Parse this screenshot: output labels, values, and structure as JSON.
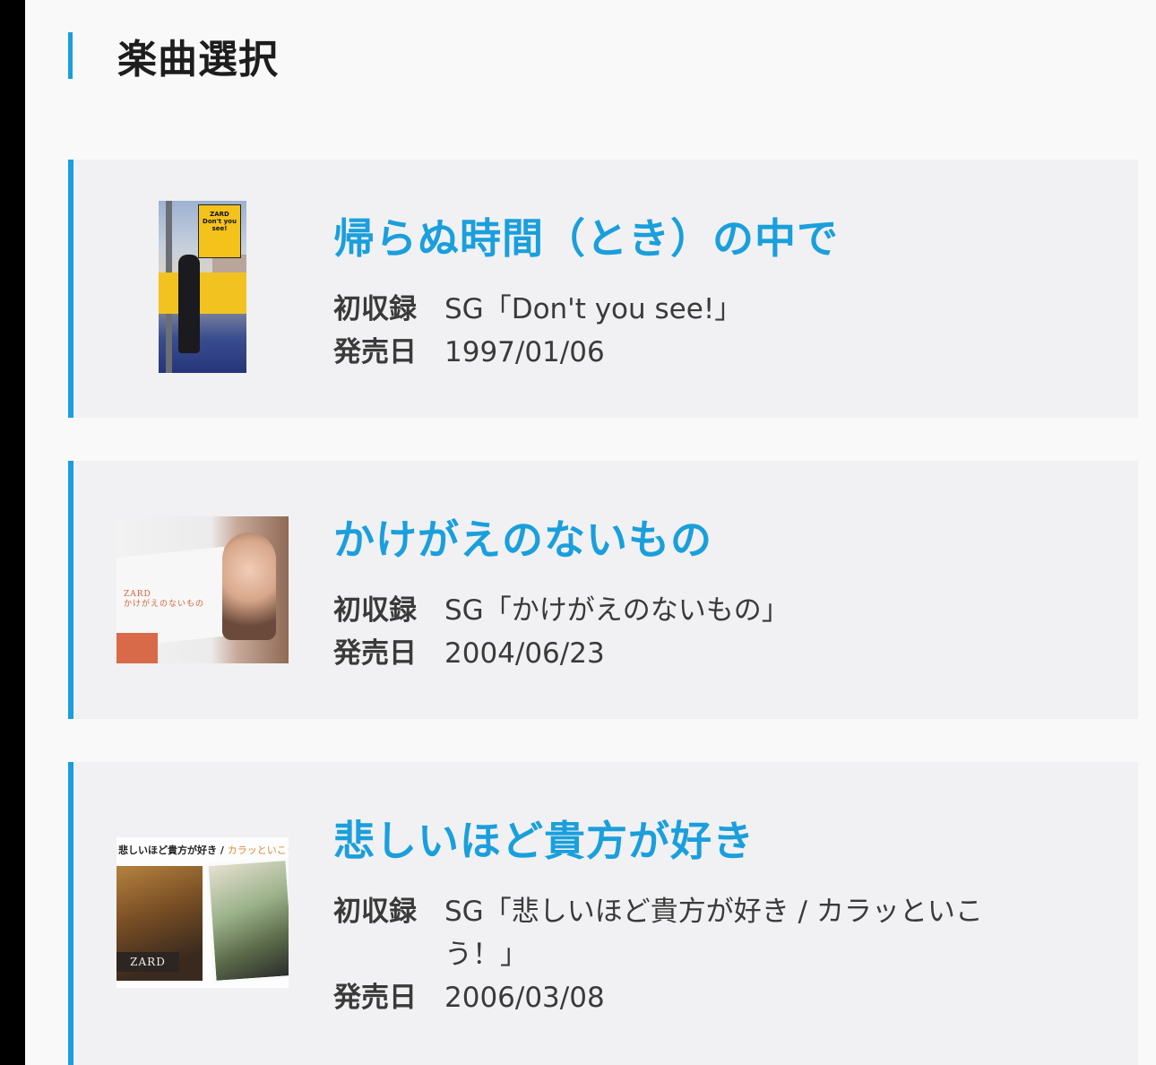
{
  "section": {
    "title": "楽曲選択"
  },
  "songs": [
    {
      "title": "帰らぬ時間（とき）の中で",
      "record_label": "初収録",
      "record_value": "SG「Don't you see!」",
      "date_label": "発売日",
      "date_value": "1997/01/06",
      "cover_text": "ZARD Don't you see!"
    },
    {
      "title": "かけがえのないもの",
      "record_label": "初収録",
      "record_value": "SG「かけがえのないもの」",
      "date_label": "発売日",
      "date_value": "2004/06/23",
      "cover_text_1": "ZARD",
      "cover_text_2": "かけがえのないもの"
    },
    {
      "title": "悲しいほど貴方が好き",
      "record_label": "初収録",
      "record_value": "SG「悲しいほど貴方が好き / カラッといこう！」",
      "date_label": "発売日",
      "date_value": "2006/03/08",
      "cover_text_1": "悲しいほど貴方が好き /",
      "cover_text_2": "カラッといこう!",
      "cover_text_3": "ZARD"
    }
  ],
  "colors": {
    "accent": "#1a9fdc",
    "card_bg": "#f1f1f3",
    "page_bg": "#f9f9fa"
  }
}
